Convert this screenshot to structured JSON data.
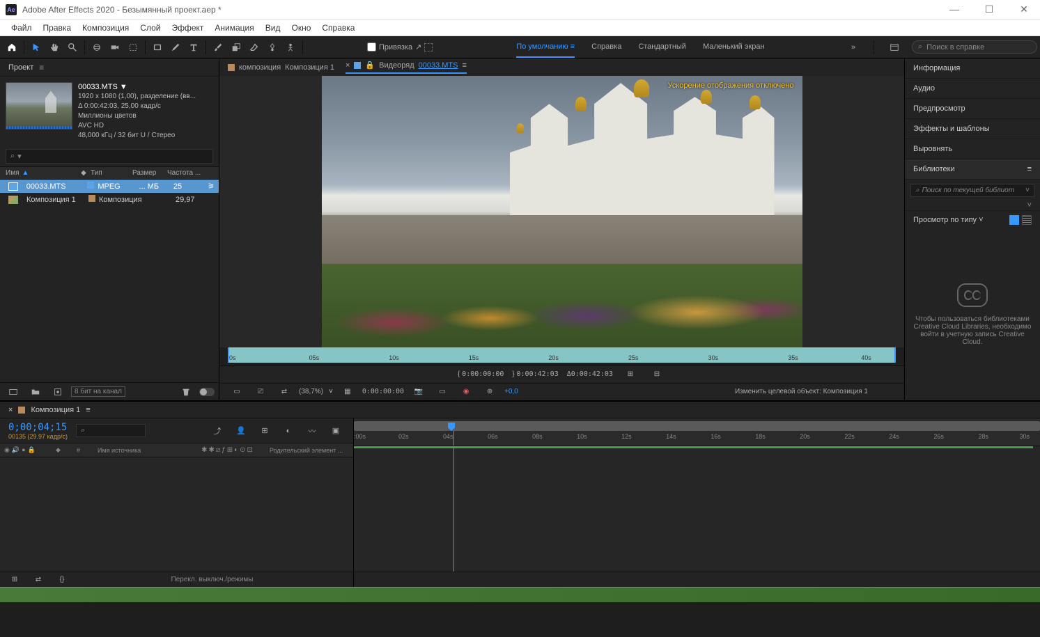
{
  "app": {
    "title": "Adobe After Effects 2020 - Безымянный проект.aep *",
    "logo": "Ae"
  },
  "menu": [
    "Файл",
    "Правка",
    "Композиция",
    "Слой",
    "Эффект",
    "Анимация",
    "Вид",
    "Окно",
    "Справка"
  ],
  "toolbar": {
    "snap_label": "Привязка",
    "workspaces": [
      "По умолчанию",
      "Справка",
      "Стандартный",
      "Маленький экран"
    ],
    "active_workspace": 0,
    "search_placeholder": "Поиск в справке"
  },
  "project": {
    "panel_title": "Проект",
    "item_name": "00033.MTS",
    "resolution": "1920 x 1080 (1,00), разделение (вв...",
    "duration": "Δ 0:00:42:03, 25,00 кадр/с",
    "colors": "Миллионы цветов",
    "codec": "AVC HD",
    "audio": "48,000 кГц / 32 бит U / Стерео",
    "cols": {
      "name": "Имя",
      "type": "Тип",
      "size": "Размер",
      "fps": "Частота ..."
    },
    "rows": [
      {
        "name": "00033.MTS",
        "type": "MPEG",
        "size": "... МБ",
        "fps": "25",
        "selected": true
      },
      {
        "name": "Композиция 1",
        "type": "Композиция",
        "size": "",
        "fps": "29,97",
        "selected": false
      }
    ],
    "footer_chan": "8 бит на канал"
  },
  "comp": {
    "tab1_prefix": "композиция",
    "tab1_name": "Композиция 1",
    "tab2_prefix": "Видеоряд",
    "tab2_link": "00033.MTS",
    "overlay": "Ускорение отображения отключено",
    "ruler_ticks": [
      "0s",
      "05s",
      "10s",
      "15s",
      "20s",
      "25s",
      "30s",
      "35s",
      "40s"
    ],
    "controls": {
      "in": "0:00:00:00",
      "out": "0:00:42:03",
      "dur": "Δ0:00:42:03"
    },
    "footer": {
      "zoom": "(38,7%)",
      "tc": "0:00:00:00",
      "offset": "+0,0",
      "target": "Изменить целевой объект: Композиция 1"
    }
  },
  "right_panels": [
    "Информация",
    "Аудио",
    "Предпросмотр",
    "Эффекты и шаблоны",
    "Выровнять",
    "Библиотеки"
  ],
  "library": {
    "search_placeholder": "Поиск по текущей библиот",
    "filter_label": "Просмотр по типу",
    "empty_msg": "Чтобы пользоваться библиотеками Creative Cloud Libraries, необходимо войти в учетную запись Creative Cloud."
  },
  "timeline": {
    "tab_name": "Композиция 1",
    "timecode": "0;00;04;15",
    "frame_info": "00135 (29.97 кадр/с)",
    "col_source": "Имя источника",
    "col_parent": "Родительский элемент ...",
    "ruler_ticks": [
      ":00s",
      "02s",
      "04s",
      "06s",
      "08s",
      "10s",
      "12s",
      "14s",
      "16s",
      "18s",
      "20s",
      "22s",
      "24s",
      "26s",
      "28s",
      "30s"
    ],
    "footer_label": "Перекл. выключ./режимы"
  }
}
